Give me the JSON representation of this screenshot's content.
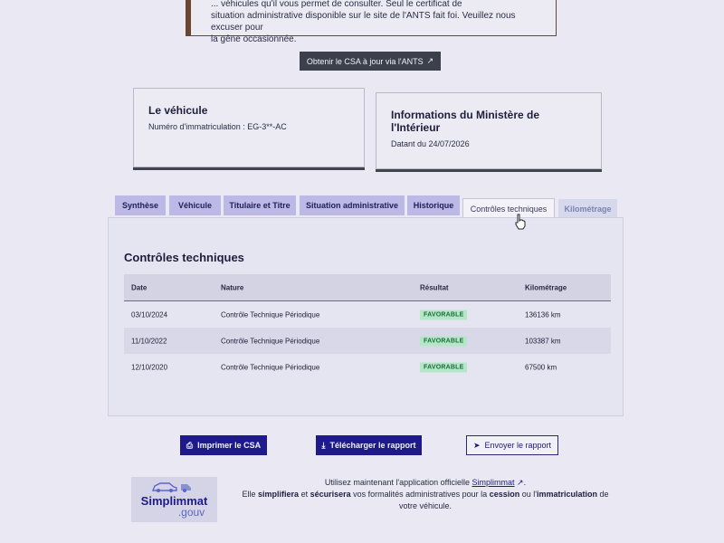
{
  "notice": {
    "line0": "... véhicules qu'il vous permet de consulter. Seul le certificat de",
    "line1": "situation administrative disponible sur le site de l'ANTS fait foi. Veuillez nous excuser pour",
    "line2": "la gêne occasionnée."
  },
  "csa_button": {
    "label": "Obtenir le CSA à jour via l'ANTS",
    "icon": "external-link-icon"
  },
  "vehicule_card": {
    "title": "Le véhicule",
    "immat_label": "Numéro d'immatriculation : EG-3**-AC"
  },
  "ministere_card": {
    "title": "Informations du Ministère de l'Intérieur",
    "date_label": "Datant du 24/07/2026"
  },
  "tabs": [
    {
      "label": "Synthèse"
    },
    {
      "label": "Véhicule"
    },
    {
      "label": "Titulaire et Titre"
    },
    {
      "label": "Situation administrative"
    },
    {
      "label": "Historique"
    },
    {
      "label": "Contrôles techniques"
    },
    {
      "label": "Kilométrage"
    }
  ],
  "controles": {
    "title": "Contrôles techniques",
    "columns": [
      "Date",
      "Nature",
      "Résultat",
      "Kilométrage"
    ],
    "rows": [
      {
        "date": "03/10/2024",
        "nature": "Contrôle Technique Périodique",
        "resultat": "FAVORABLE",
        "km": "136136 km"
      },
      {
        "date": "11/10/2022",
        "nature": "Contrôle Technique Périodique",
        "resultat": "FAVORABLE",
        "km": "103387 km"
      },
      {
        "date": "12/10/2020",
        "nature": "Contrôle Technique Périodique",
        "resultat": "FAVORABLE",
        "km": "67500 km"
      }
    ]
  },
  "actions": {
    "print": "Imprimer le CSA",
    "download": "Télécharger le rapport",
    "send": "Envoyer le rapport"
  },
  "footer": {
    "line1_pre": "Utilisez maintenant l'application officielle ",
    "app_link": "Simplimmat",
    "line2_a": "Elle ",
    "line2_b": "simplifiera",
    "line2_c": " et ",
    "line2_d": "sécurisera",
    "line2_e": " vos formalités administratives pour la ",
    "line2_f": "cession",
    "line2_g": " ou l'",
    "line2_h": "immatriculation",
    "line2_i": " de",
    "line3": "votre véhicule."
  },
  "logo": {
    "name": "Simplimmat",
    "suffix": ".gouv"
  },
  "colors": {
    "primary": "#1e1a8c",
    "tab": "#bdb9e6",
    "badge_bg": "#b3e7c7",
    "badge_text": "#1e6a3a"
  }
}
